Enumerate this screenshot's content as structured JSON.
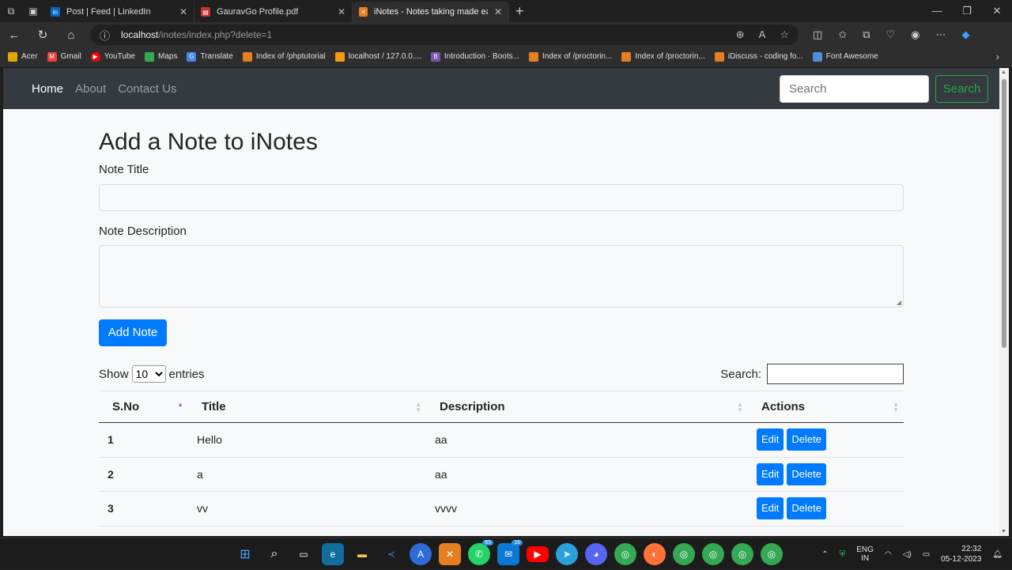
{
  "browser": {
    "tabs": [
      {
        "label": "Post | Feed | LinkedIn",
        "fav": "in",
        "color": "#0a66c2",
        "active": false
      },
      {
        "label": "GauravGo Profile.pdf",
        "fav": "pdf",
        "color": "#c9302c",
        "active": false
      },
      {
        "label": "iNotes - Notes taking made easy",
        "fav": "xa",
        "color": "#e67e22",
        "active": true
      }
    ],
    "url_host": "localhost",
    "url_path": "/inotes/index.php?delete=1",
    "bookmarks": [
      {
        "label": "Acer",
        "color": "#e0a800"
      },
      {
        "label": "Gmail",
        "color": "#ea4335"
      },
      {
        "label": "YouTube",
        "color": "#ff0000"
      },
      {
        "label": "Maps",
        "color": "#34a853"
      },
      {
        "label": "Translate",
        "color": "#4285f4"
      },
      {
        "label": "Index of /phptutorial",
        "color": "#e67e22"
      },
      {
        "label": "localhost / 127.0.0....",
        "color": "#f39c12"
      },
      {
        "label": "Introduction · Boots...",
        "color": "#7952b3"
      },
      {
        "label": "Index of /proctorin...",
        "color": "#e67e22"
      },
      {
        "label": "Index of /proctorin...",
        "color": "#e67e22"
      },
      {
        "label": "iDiscuss - coding fo...",
        "color": "#e67e22"
      },
      {
        "label": "Font Awesome",
        "color": "#528dd7"
      }
    ]
  },
  "navbar": {
    "links": [
      "Home",
      "About",
      "Contact Us"
    ],
    "search_placeholder": "Search",
    "search_button": "Search"
  },
  "form": {
    "heading": "Add a Note to iNotes",
    "title_label": "Note Title",
    "desc_label": "Note Description",
    "submit_label": "Add Note"
  },
  "datatable": {
    "show_label": "Show",
    "entries_value": "10",
    "entries_label": "entries",
    "search_label": "Search:",
    "columns": [
      "S.No",
      "Title",
      "Description",
      "Actions"
    ],
    "rows": [
      {
        "sno": "1",
        "title": "Hello",
        "description": "aa"
      },
      {
        "sno": "2",
        "title": "a",
        "description": "aa"
      },
      {
        "sno": "3",
        "title": "vv",
        "description": "vvvv"
      }
    ],
    "edit_label": "Edit",
    "delete_label": "Delete"
  },
  "taskbar": {
    "lang_top": "ENG",
    "lang_bottom": "IN",
    "time": "22:32",
    "date": "05-12-2023",
    "badges": {
      "whatsapp": "65",
      "mail": "16"
    }
  }
}
